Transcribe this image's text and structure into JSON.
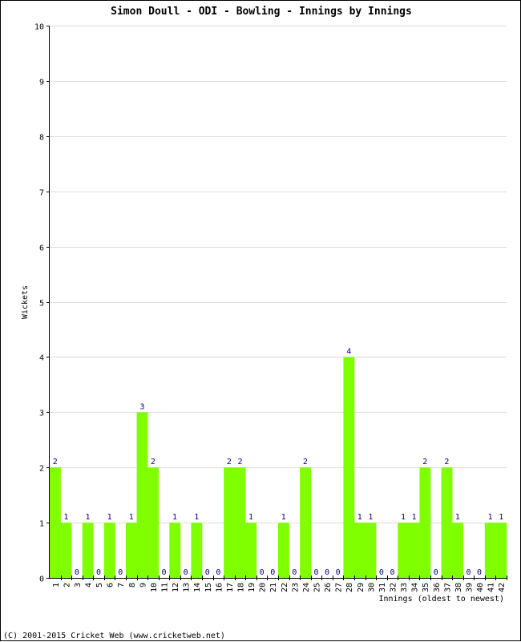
{
  "chart_data": {
    "type": "bar",
    "title": "Simon Doull - ODI - Bowling - Innings by Innings",
    "xlabel": "Innings (oldest to newest)",
    "ylabel": "Wickets",
    "ylim": [
      0,
      10
    ],
    "yticks": [
      "0",
      "1",
      "2",
      "3",
      "4",
      "5",
      "6",
      "7",
      "8",
      "9",
      "10"
    ],
    "grid": true,
    "categories": [
      "1",
      "2",
      "3",
      "4",
      "5",
      "6",
      "7",
      "8",
      "9",
      "10",
      "11",
      "12",
      "13",
      "14",
      "15",
      "16",
      "17",
      "18",
      "19",
      "20",
      "21",
      "22",
      "23",
      "24",
      "25",
      "26",
      "27",
      "28",
      "29",
      "30",
      "31",
      "32",
      "33",
      "34",
      "35",
      "36",
      "37",
      "38",
      "39",
      "40",
      "41",
      "42"
    ],
    "values": [
      2,
      1,
      0,
      1,
      0,
      1,
      0,
      1,
      3,
      2,
      0,
      1,
      0,
      1,
      0,
      0,
      2,
      2,
      1,
      0,
      0,
      1,
      0,
      2,
      0,
      0,
      0,
      4,
      1,
      1,
      0,
      0,
      1,
      1,
      2,
      0,
      2,
      1,
      0,
      0,
      1,
      1
    ],
    "bar_color": "#80ff00",
    "label_color": "#000080",
    "grid_color": "#dddddd"
  },
  "footer": "(C) 2001-2015 Cricket Web (www.cricketweb.net)"
}
